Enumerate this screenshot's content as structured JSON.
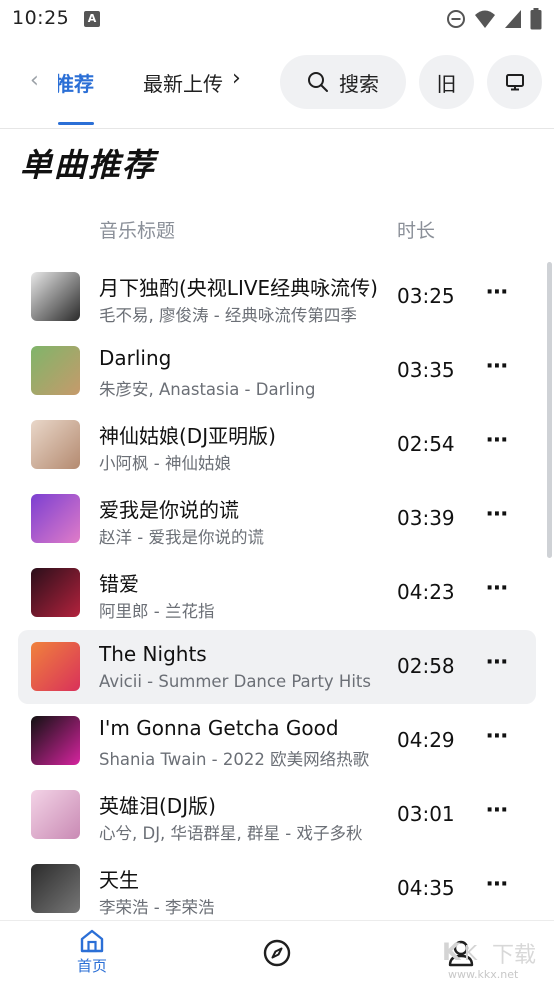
{
  "status_bar": {
    "time": "10:25",
    "notif_letter": "A"
  },
  "header": {
    "tab_recommend": "推荐",
    "tab_latest": "最新上传",
    "search_label": "搜索",
    "old_label": "旧"
  },
  "section_title": "单曲推荐",
  "columns": {
    "title": "音乐标题",
    "duration": "时长"
  },
  "songs": [
    {
      "title": "月下独酌(央视LIVE经典咏流传)",
      "subtitle": "毛不易, 廖俊涛 - 经典咏流传第四季",
      "duration": "03:25",
      "cover_colors": [
        "#e8e8e8",
        "#2a2a2a"
      ]
    },
    {
      "title": "Darling",
      "subtitle": "朱彦安, Anastasia - Darling",
      "duration": "03:35",
      "cover_colors": [
        "#7fb56a",
        "#c69a6b"
      ]
    },
    {
      "title": "神仙姑娘(DJ亚明版)",
      "subtitle": "小阿枫 - 神仙姑娘",
      "duration": "02:54",
      "cover_colors": [
        "#e9d7c9",
        "#b48a70"
      ]
    },
    {
      "title": "爱我是你说的谎",
      "subtitle": "赵洋 - 爱我是你说的谎",
      "duration": "03:39",
      "cover_colors": [
        "#7b3fd1",
        "#e07cc8"
      ]
    },
    {
      "title": "错爱",
      "subtitle": "阿里郎 - 兰花指",
      "duration": "04:23",
      "cover_colors": [
        "#2a0f1a",
        "#b3223d"
      ]
    },
    {
      "title": "The Nights",
      "subtitle": "Avicii - Summer Dance Party Hits",
      "duration": "02:58",
      "cover_colors": [
        "#f0823c",
        "#d9315a"
      ]
    },
    {
      "title": "I'm Gonna Getcha Good",
      "subtitle": "Shania Twain - 2022 欧美网络热歌",
      "duration": "04:29",
      "cover_colors": [
        "#111111",
        "#d6249f"
      ]
    },
    {
      "title": "英雄泪(DJ版)",
      "subtitle": "心兮, DJ, 华语群星, 群星 - 戏子多秋",
      "duration": "03:01",
      "cover_colors": [
        "#f3d3e6",
        "#c98ab4"
      ]
    },
    {
      "title": "天生",
      "subtitle": "李荣浩 - 李荣浩",
      "duration": "04:35",
      "cover_colors": [
        "#2b2b2b",
        "#777777"
      ]
    }
  ],
  "bottom_nav": {
    "home_label": "首页"
  },
  "watermark": "www.kkx.net",
  "colors": {
    "accent": "#2b6fd6",
    "active_row": "#f0f1f3"
  }
}
